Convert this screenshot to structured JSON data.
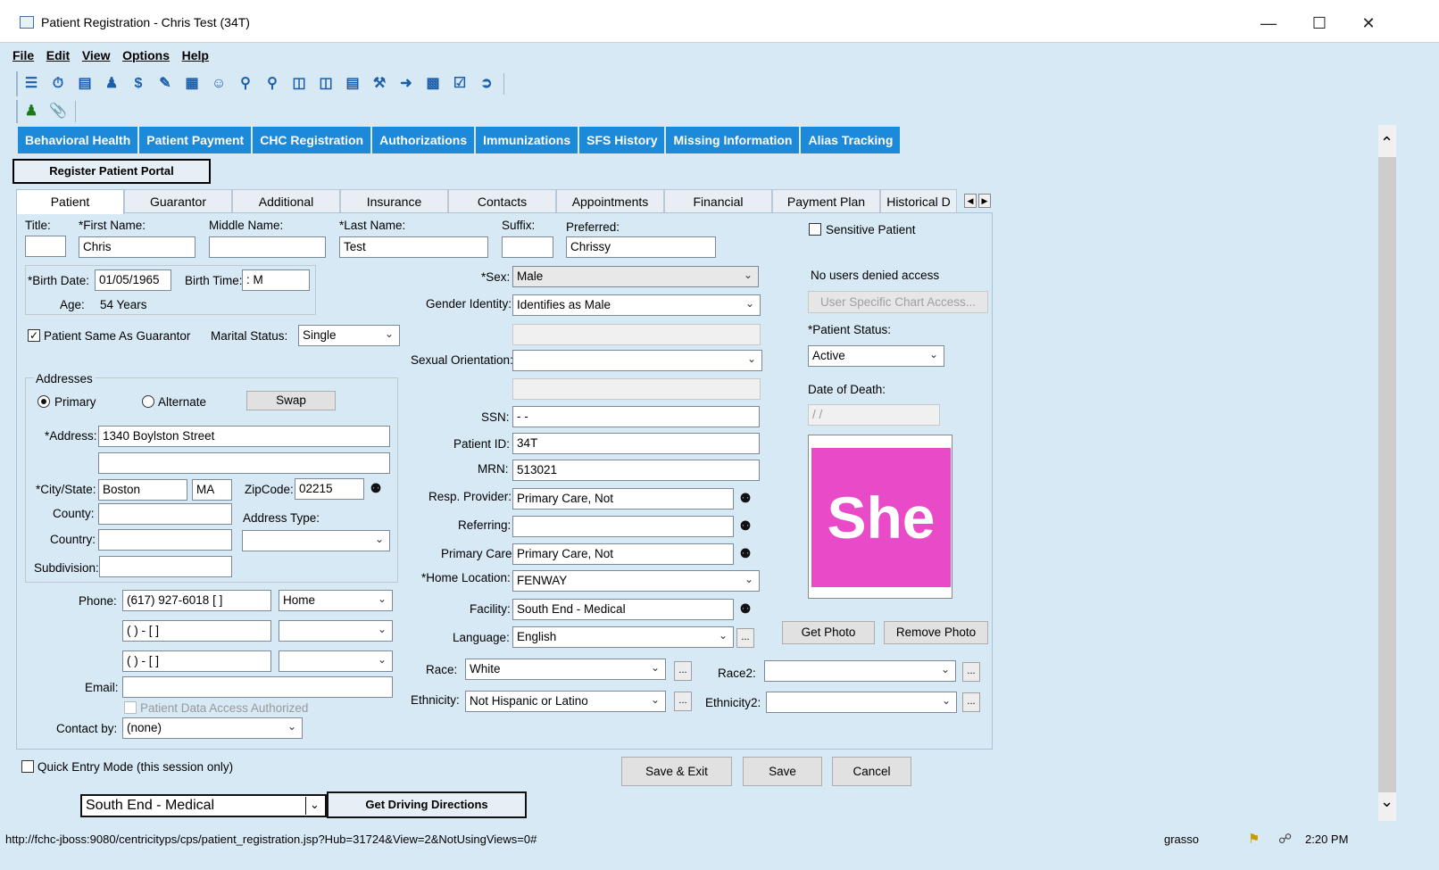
{
  "window": {
    "title": "Patient Registration - Chris Test (34T)"
  },
  "menu": [
    "File",
    "Edit",
    "View",
    "Options",
    "Help"
  ],
  "nav_tabs": [
    "Behavioral Health",
    "Patient Payment",
    "CHC Registration",
    "Authorizations",
    "Immunizations",
    "SFS History",
    "Missing Information",
    "Alias Tracking"
  ],
  "register_portal_label": "Register Patient Portal",
  "tabs": [
    "Patient",
    "Guarantor",
    "Additional",
    "Insurance",
    "Contacts",
    "Appointments",
    "Financial",
    "Payment Plan",
    "Historical D"
  ],
  "name": {
    "title_label": "Title:",
    "first_label": "*First Name:",
    "middle_label": "Middle Name:",
    "last_label": "*Last Name:",
    "suffix_label": "Suffix:",
    "preferred_label": "Preferred:",
    "title": "",
    "first": "Chris",
    "middle": "",
    "last": "Test",
    "suffix": "",
    "preferred": "Chrissy"
  },
  "birth": {
    "date_label": "*Birth Date:",
    "date": "01/05/1965",
    "time_label": "Birth Time:",
    "time": " :   M",
    "age_label": "Age:",
    "age": "54 Years"
  },
  "same_as_guarantor_label": "Patient Same As Guarantor",
  "marital": {
    "label": "Marital Status:",
    "value": "Single"
  },
  "address": {
    "group_label": "Addresses",
    "primary": "Primary",
    "alternate": "Alternate",
    "swap": "Swap",
    "address_label": "*Address:",
    "line1": "1340 Boylston Street",
    "line2": "",
    "city_label": "*City/State:",
    "city": "Boston",
    "state": "MA",
    "zip_label": "ZipCode:",
    "zip": "02215",
    "county_label": "County:",
    "country_label": "Country:",
    "subdivision_label": "Subdivision:",
    "type_label": "Address Type:"
  },
  "phone": {
    "label": "Phone:",
    "p1": "(617) 927-6018 [   ]",
    "t1": "Home",
    "p2": "(  )   -     [   ]",
    "p3": "(  )   -     [   ]"
  },
  "email_label": "Email:",
  "data_access_label": "Patient Data Access Authorized",
  "contact_by": {
    "label": "Contact by:",
    "value": "(none)"
  },
  "mid": {
    "sex_label": "*Sex:",
    "sex": "Male",
    "gender_label": "Gender Identity:",
    "gender": "Identifies as Male",
    "orientation_label": "Sexual Orientation:",
    "ssn_label": "SSN:",
    "ssn": "  -  -",
    "pid_label": "Patient ID:",
    "pid": "34T",
    "mrn_label": "MRN:",
    "mrn": "513021",
    "resp_label": "Resp. Provider:",
    "resp": "Primary Care, Not",
    "ref_label": "Referring:",
    "ref": "",
    "pc_label": "Primary Care:",
    "pc": "Primary Care, Not",
    "home_label": "*Home Location:",
    "home": "FENWAY",
    "facility_label": "Facility:",
    "facility": "South End - Medical",
    "lang_label": "Language:",
    "lang": "English",
    "race_label": "Race:",
    "race": "White",
    "race2_label": "Race2:",
    "eth_label": "Ethnicity:",
    "eth": "Not Hispanic or Latino",
    "eth2_label": "Ethnicity2:"
  },
  "right": {
    "sensitive_label": "Sensitive Patient",
    "denied": "No users denied access",
    "chart_access": "User Specific Chart Access...",
    "status_label": "*Patient Status:",
    "status": "Active",
    "death_label": "Date of Death:",
    "death": " /  /",
    "photo_text": "She",
    "get_photo": "Get Photo",
    "remove_photo": "Remove Photo"
  },
  "quick_entry_label": "Quick Entry Mode (this session only)",
  "buttons": {
    "save_exit": "Save & Exit",
    "save": "Save",
    "cancel": "Cancel"
  },
  "bottom": {
    "location": "South End - Medical",
    "directions": "Get Driving Directions"
  },
  "status": {
    "url": "http://fchc-jboss:9080/centricityps/cps/patient_registration.jsp?Hub=31724&View=2&NotUsingViews=0#",
    "user": "grasso",
    "time": "2:20 PM"
  }
}
